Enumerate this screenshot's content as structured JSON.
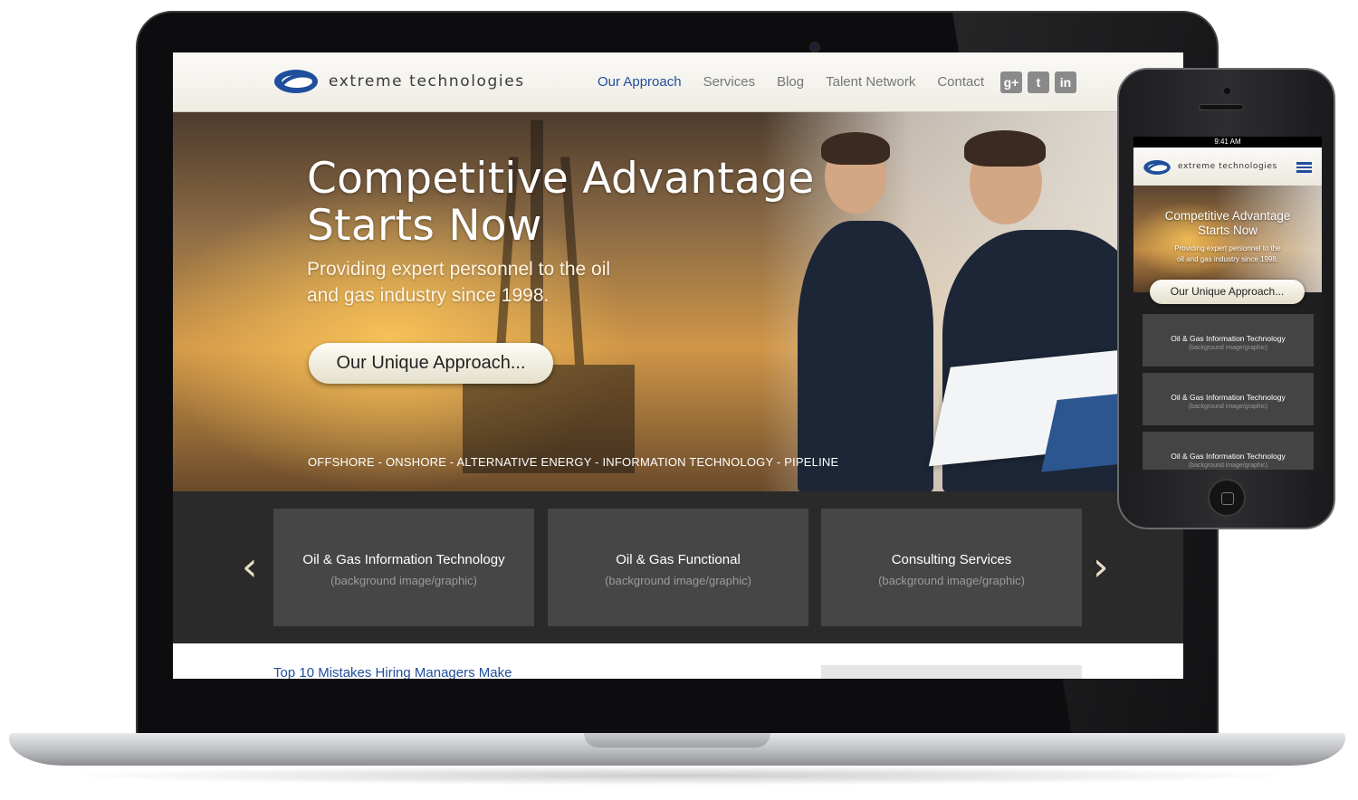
{
  "desktop": {
    "header": {
      "logo_text": "extreme technologies",
      "nav": [
        "Our Approach",
        "Services",
        "Blog",
        "Talent Network",
        "Contact"
      ],
      "active_nav": "Our Approach",
      "socials": [
        "g+",
        "t",
        "in"
      ]
    },
    "hero": {
      "title_line1": "Competitive Advantage",
      "title_line2": "Starts Now",
      "subtitle_line1": "Providing expert personnel to the oil",
      "subtitle_line2": "and gas industry since 1998.",
      "button": "Our Unique Approach...",
      "tags": "OFFSHORE - ONSHORE - ALTERNATIVE ENERGY - INFORMATION TECHNOLOGY - PIPELINE"
    },
    "carousel": {
      "prev_icon": "chevron-left-icon",
      "next_icon": "chevron-right-icon",
      "cards": [
        {
          "title": "Oil & Gas Information Technology",
          "subtitle": "(background image/graphic)"
        },
        {
          "title": "Oil & Gas Functional",
          "subtitle": "(background image/graphic)"
        },
        {
          "title": "Consulting Services",
          "subtitle": "(background image/graphic)"
        }
      ]
    },
    "below": {
      "article_link": "Top 10 Mistakes Hiring Managers Make"
    }
  },
  "mobile": {
    "status_time": "9:41 AM",
    "logo_text": "extreme technologies",
    "menu_icon": "hamburger-menu-icon",
    "hero": {
      "title_line1": "Competitive Advantage",
      "title_line2": "Starts Now",
      "subtitle_line1": "Providing expert personnel to the",
      "subtitle_line2": "oil and gas industry since 1998.",
      "button": "Our Unique Approach..."
    },
    "cards": [
      {
        "title": "Oil & Gas Information Technology",
        "subtitle": "(background image/graphic)"
      },
      {
        "title": "Oil & Gas Information Technology",
        "subtitle": "(background image/graphic)"
      },
      {
        "title": "Oil & Gas Information Technology",
        "subtitle": "(background image/graphic)"
      }
    ]
  },
  "colors": {
    "brand_blue": "#1f4e9c",
    "header_bg": "#f4f2ec",
    "carousel_bg": "#2a2a2a",
    "card_bg": "#464646",
    "button_bg": "#f3f0e0"
  }
}
